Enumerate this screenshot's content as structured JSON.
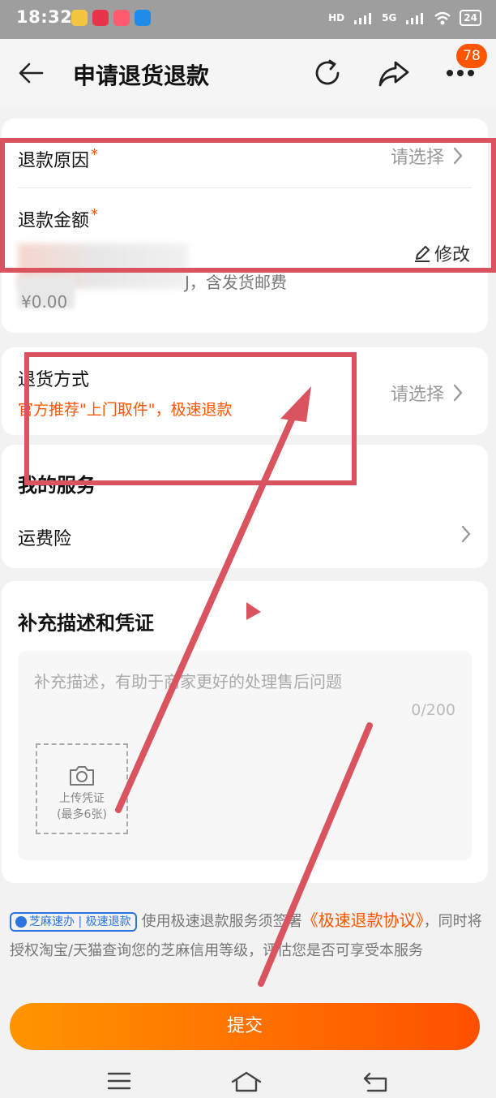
{
  "status_bar": {
    "time": "18:32",
    "battery": "24",
    "net1": "HD",
    "net2": "5G"
  },
  "nav": {
    "title": "申请退货退款",
    "badge": "78"
  },
  "refund_card": {
    "reason_label": "退款原因",
    "reason_value": "请选择",
    "amount_label": "退款金额",
    "required_mark": "*",
    "edit_label": "修改",
    "amount_note": "J，含发货邮费",
    "amount_value": "¥0.00"
  },
  "return_method": {
    "label": "退货方式",
    "value": "请选择",
    "tip": "官方推荐\"上门取件\"，极速退款"
  },
  "services": {
    "title": "我的服务",
    "item": "运费险"
  },
  "evidence": {
    "title": "补充描述和凭证",
    "placeholder": "补充描述，有助于商家更好的处理售后问题",
    "count": "0/200",
    "upload_line1": "上传凭证",
    "upload_line2": "(最多6张)"
  },
  "agreement": {
    "tag": "芝麻速办 | 极速退款",
    "text1": "使用极速退款服务须签署",
    "link": "《极速退款协议》",
    "text2": "，同时将授权淘宝/天猫查询您的芝麻信用等级，评估您是否可享受本服务"
  },
  "submit_label": "提交",
  "colors": {
    "accent": "#ff5400",
    "annotation": "#d9545f",
    "tag_blue": "#2b74e0"
  }
}
